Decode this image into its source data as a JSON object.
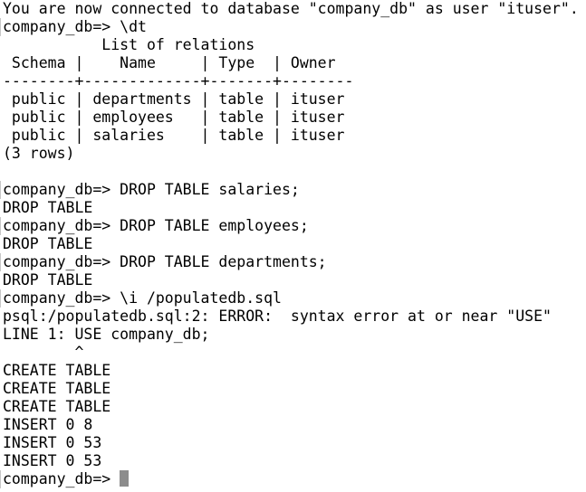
{
  "terminal": {
    "lines": [
      {
        "text": "You are now connected to database \"company_db\" as user \"ituser\".",
        "kind": "output"
      },
      {
        "text": "company_db=> \\dt",
        "kind": "prompt"
      },
      {
        "text": "           List of relations",
        "kind": "output"
      },
      {
        "text": " Schema |    Name     | Type  | Owner",
        "kind": "output"
      },
      {
        "text": "--------+-------------+-------+--------",
        "kind": "output"
      },
      {
        "text": " public | departments | table | ituser",
        "kind": "output"
      },
      {
        "text": " public | employees   | table | ituser",
        "kind": "output"
      },
      {
        "text": " public | salaries    | table | ituser",
        "kind": "output"
      },
      {
        "text": "(3 rows)",
        "kind": "output"
      },
      {
        "text": "",
        "kind": "blank"
      },
      {
        "text": "company_db=> DROP TABLE salaries;",
        "kind": "prompt"
      },
      {
        "text": "DROP TABLE",
        "kind": "output"
      },
      {
        "text": "company_db=> DROP TABLE employees;",
        "kind": "prompt"
      },
      {
        "text": "DROP TABLE",
        "kind": "output"
      },
      {
        "text": "company_db=> DROP TABLE departments;",
        "kind": "prompt"
      },
      {
        "text": "DROP TABLE",
        "kind": "output"
      },
      {
        "text": "company_db=> \\i /populatedb.sql",
        "kind": "prompt"
      },
      {
        "text": "psql:/populatedb.sql:2: ERROR:  syntax error at or near \"USE\"",
        "kind": "output"
      },
      {
        "text": "LINE 1: USE company_db;",
        "kind": "output"
      },
      {
        "text": "        ^",
        "kind": "output"
      },
      {
        "text": "CREATE TABLE",
        "kind": "output"
      },
      {
        "text": "CREATE TABLE",
        "kind": "output"
      },
      {
        "text": "CREATE TABLE",
        "kind": "output"
      },
      {
        "text": "INSERT 0 8",
        "kind": "output"
      },
      {
        "text": "INSERT 0 53",
        "kind": "output"
      },
      {
        "text": "INSERT 0 53",
        "kind": "output"
      }
    ],
    "current_prompt": "company_db=> "
  }
}
